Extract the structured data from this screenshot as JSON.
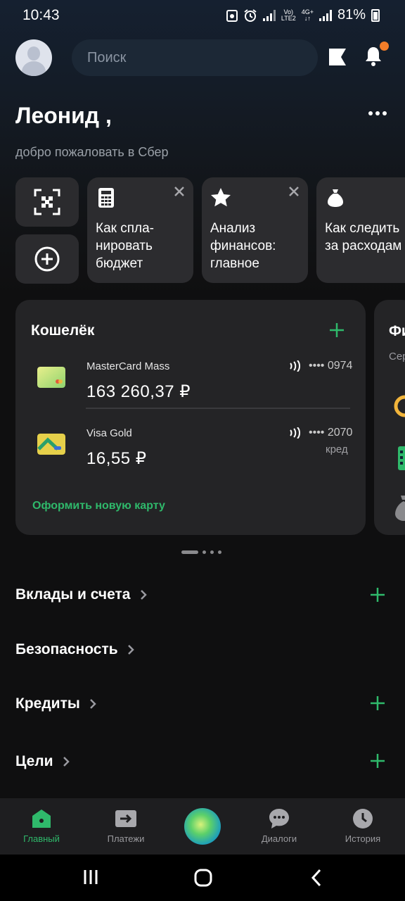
{
  "status_bar": {
    "time": "10:43",
    "battery": "81%",
    "network_top": "Vo)",
    "network_bottom": "LTE2",
    "net_type": "4G+"
  },
  "header": {
    "search_placeholder": "Поиск"
  },
  "greeting": {
    "name": "Леонид ,",
    "welcome": "добро пожаловать в Сбер"
  },
  "stories": [
    {
      "text": "Как спла-\nнировать\nбюджет",
      "icon": "calculator-icon"
    },
    {
      "text": "Анализ\nфинансов:\nглавное",
      "icon": "star-icon"
    },
    {
      "text": "Как следить\nза расходам",
      "icon": "money-bag-icon"
    }
  ],
  "wallet": {
    "title": "Кошелёк",
    "cards": [
      {
        "name": "MasterCard Mass",
        "amount": "163 260,37 ₽",
        "number": "•••• 0974",
        "note": ""
      },
      {
        "name": "Visa Gold",
        "amount": "16,55 ₽",
        "number": "•••• 2070",
        "note": "кред"
      }
    ],
    "new_card": "Оформить новую карту"
  },
  "next_card": {
    "title": "Фи",
    "subtitle": "Сер"
  },
  "sections": [
    {
      "label": "Вклады и счета",
      "has_add": true
    },
    {
      "label": "Безопасность",
      "has_add": false
    },
    {
      "label": "Кредиты",
      "has_add": true
    },
    {
      "label": "Цели",
      "has_add": true
    }
  ],
  "bottom_nav": [
    {
      "label": "Главный",
      "active": true
    },
    {
      "label": "Платежи",
      "active": false
    },
    {
      "label": "Диалоги",
      "active": false
    },
    {
      "label": "История",
      "active": false
    }
  ],
  "colors": {
    "accent": "#2fb96b",
    "notification": "#f27d29",
    "surface": "#242426",
    "background": "#0f0f10"
  }
}
